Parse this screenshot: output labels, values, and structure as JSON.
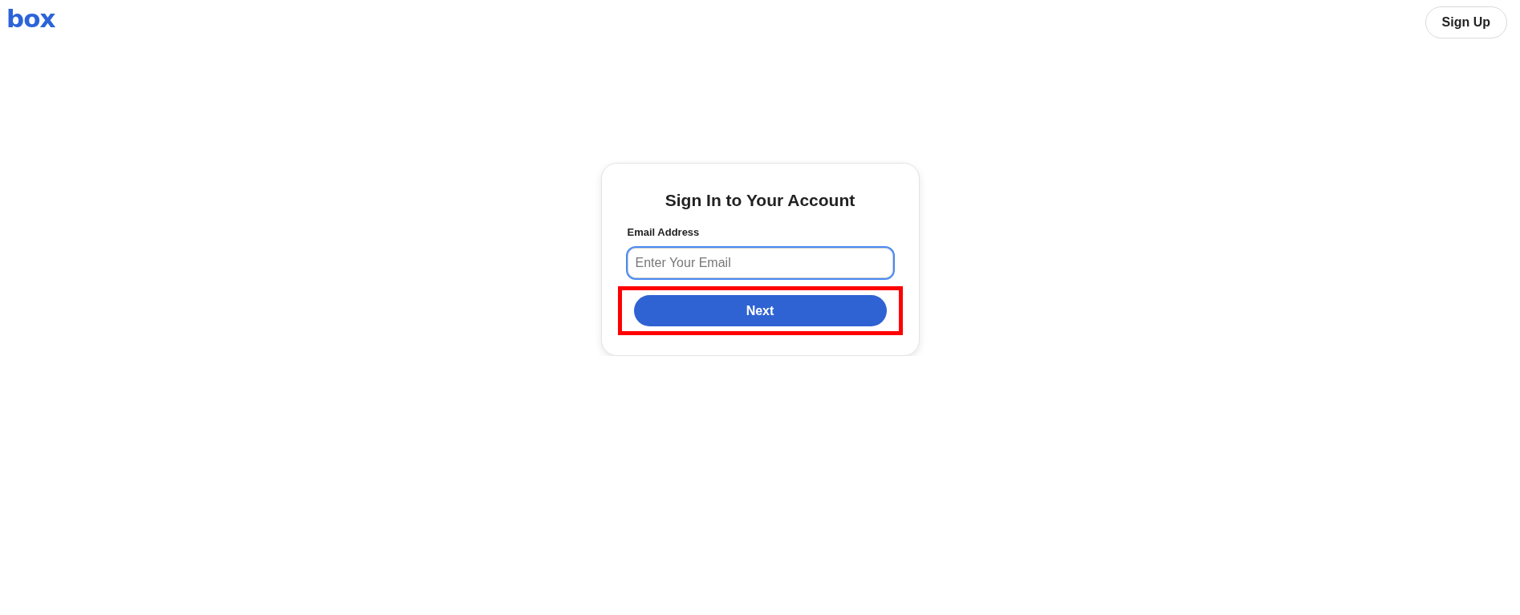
{
  "header": {
    "logo": "box",
    "signup_button": "Sign Up"
  },
  "card": {
    "title": "Sign In to Your Account",
    "email_field": {
      "label": "Email Address",
      "placeholder": "Enter Your Email",
      "focused": true
    },
    "next_button": {
      "label": "Next",
      "highlighted": true
    }
  }
}
